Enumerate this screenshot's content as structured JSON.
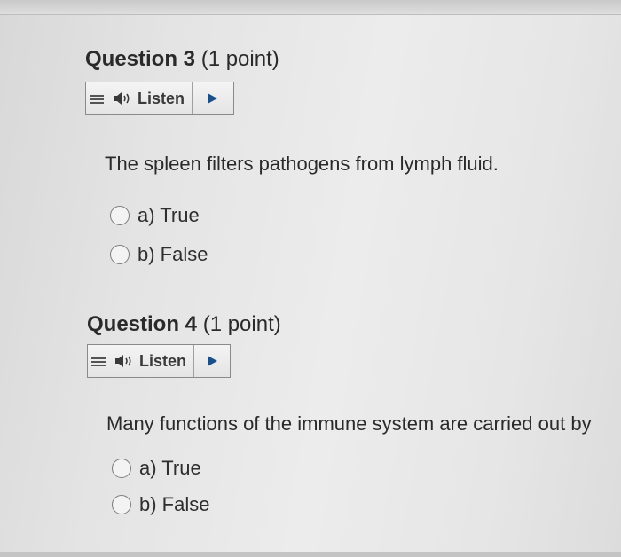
{
  "questions": [
    {
      "label": "Question 3",
      "points": "(1 point)",
      "listen_label": "Listen",
      "text": "The spleen filters pathogens from lymph fluid.",
      "options": [
        {
          "label": "a) True"
        },
        {
          "label": "b) False"
        }
      ]
    },
    {
      "label": "Question 4",
      "points": "(1 point)",
      "listen_label": "Listen",
      "text": "Many functions of the immune system are carried out by",
      "options": [
        {
          "label": "a) True"
        },
        {
          "label": "b) False"
        }
      ]
    }
  ],
  "icons": {
    "menu": "menu-icon",
    "speaker": "speaker-icon",
    "play": "play-icon",
    "radio": "radio-button"
  },
  "colors": {
    "play_accent": "#1c4f86",
    "text": "#2a2a2a",
    "widget_border": "#8a8a8a"
  }
}
